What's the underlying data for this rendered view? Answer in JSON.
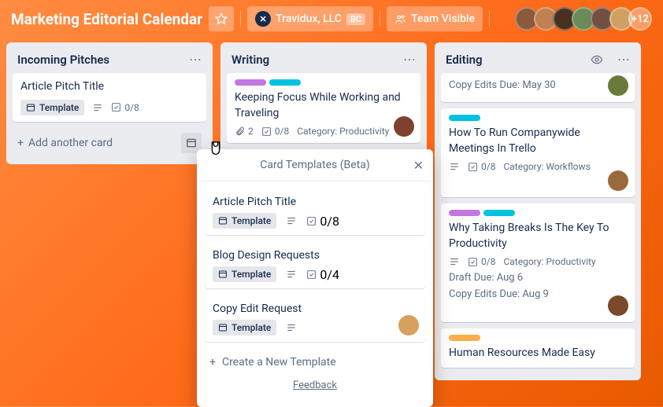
{
  "header": {
    "board_title": "Marketing Editorial Calendar",
    "org_name": "Travidux, LLC",
    "org_badge": "BC",
    "visibility": "Team Visible",
    "avatar_more": "+12"
  },
  "lists": [
    {
      "title": "Incoming Pitches",
      "cards": [
        {
          "title": "Article Pitch Title",
          "template": "Template",
          "checklist": "0/8"
        }
      ],
      "add_card": "Add another card"
    },
    {
      "title": "Writing",
      "cards": [
        {
          "labels": [
            "purple",
            "teal"
          ],
          "title": "Keeping Focus While Working and Traveling",
          "attachments": "2",
          "checklist": "0/8",
          "category": "Category: Productivity"
        }
      ]
    },
    {
      "title": "Editing",
      "watching": true,
      "cards": [
        {
          "due": "Copy Edits Due: May 30",
          "has_member": true
        },
        {
          "labels": [
            "teal"
          ],
          "title": "How To Run Companywide Meetings In Trello",
          "checklist": "0/8",
          "category": "Category: Workflows",
          "has_member": true
        },
        {
          "labels": [
            "purple",
            "teal"
          ],
          "title": "Why Taking Breaks Is The Key To Productivity",
          "checklist": "0/8",
          "category": "Category: Productivity",
          "draft_due": "Draft Due: Aug 6",
          "copy_due": "Copy Edits Due: Aug 9",
          "has_member": true
        },
        {
          "labels": [
            "orange"
          ],
          "title": "Human Resources Made Easy"
        }
      ]
    }
  ],
  "popover": {
    "title": "Card Templates (Beta)",
    "templates": [
      {
        "title": "Article Pitch Title",
        "template_label": "Template",
        "checklist": "0/8"
      },
      {
        "title": "Blog Design Requests",
        "template_label": "Template",
        "checklist": "0/4"
      },
      {
        "title": "Copy Edit Request",
        "template_label": "Template",
        "has_member": true
      }
    ],
    "create": "Create a New Template",
    "feedback": "Feedback"
  }
}
